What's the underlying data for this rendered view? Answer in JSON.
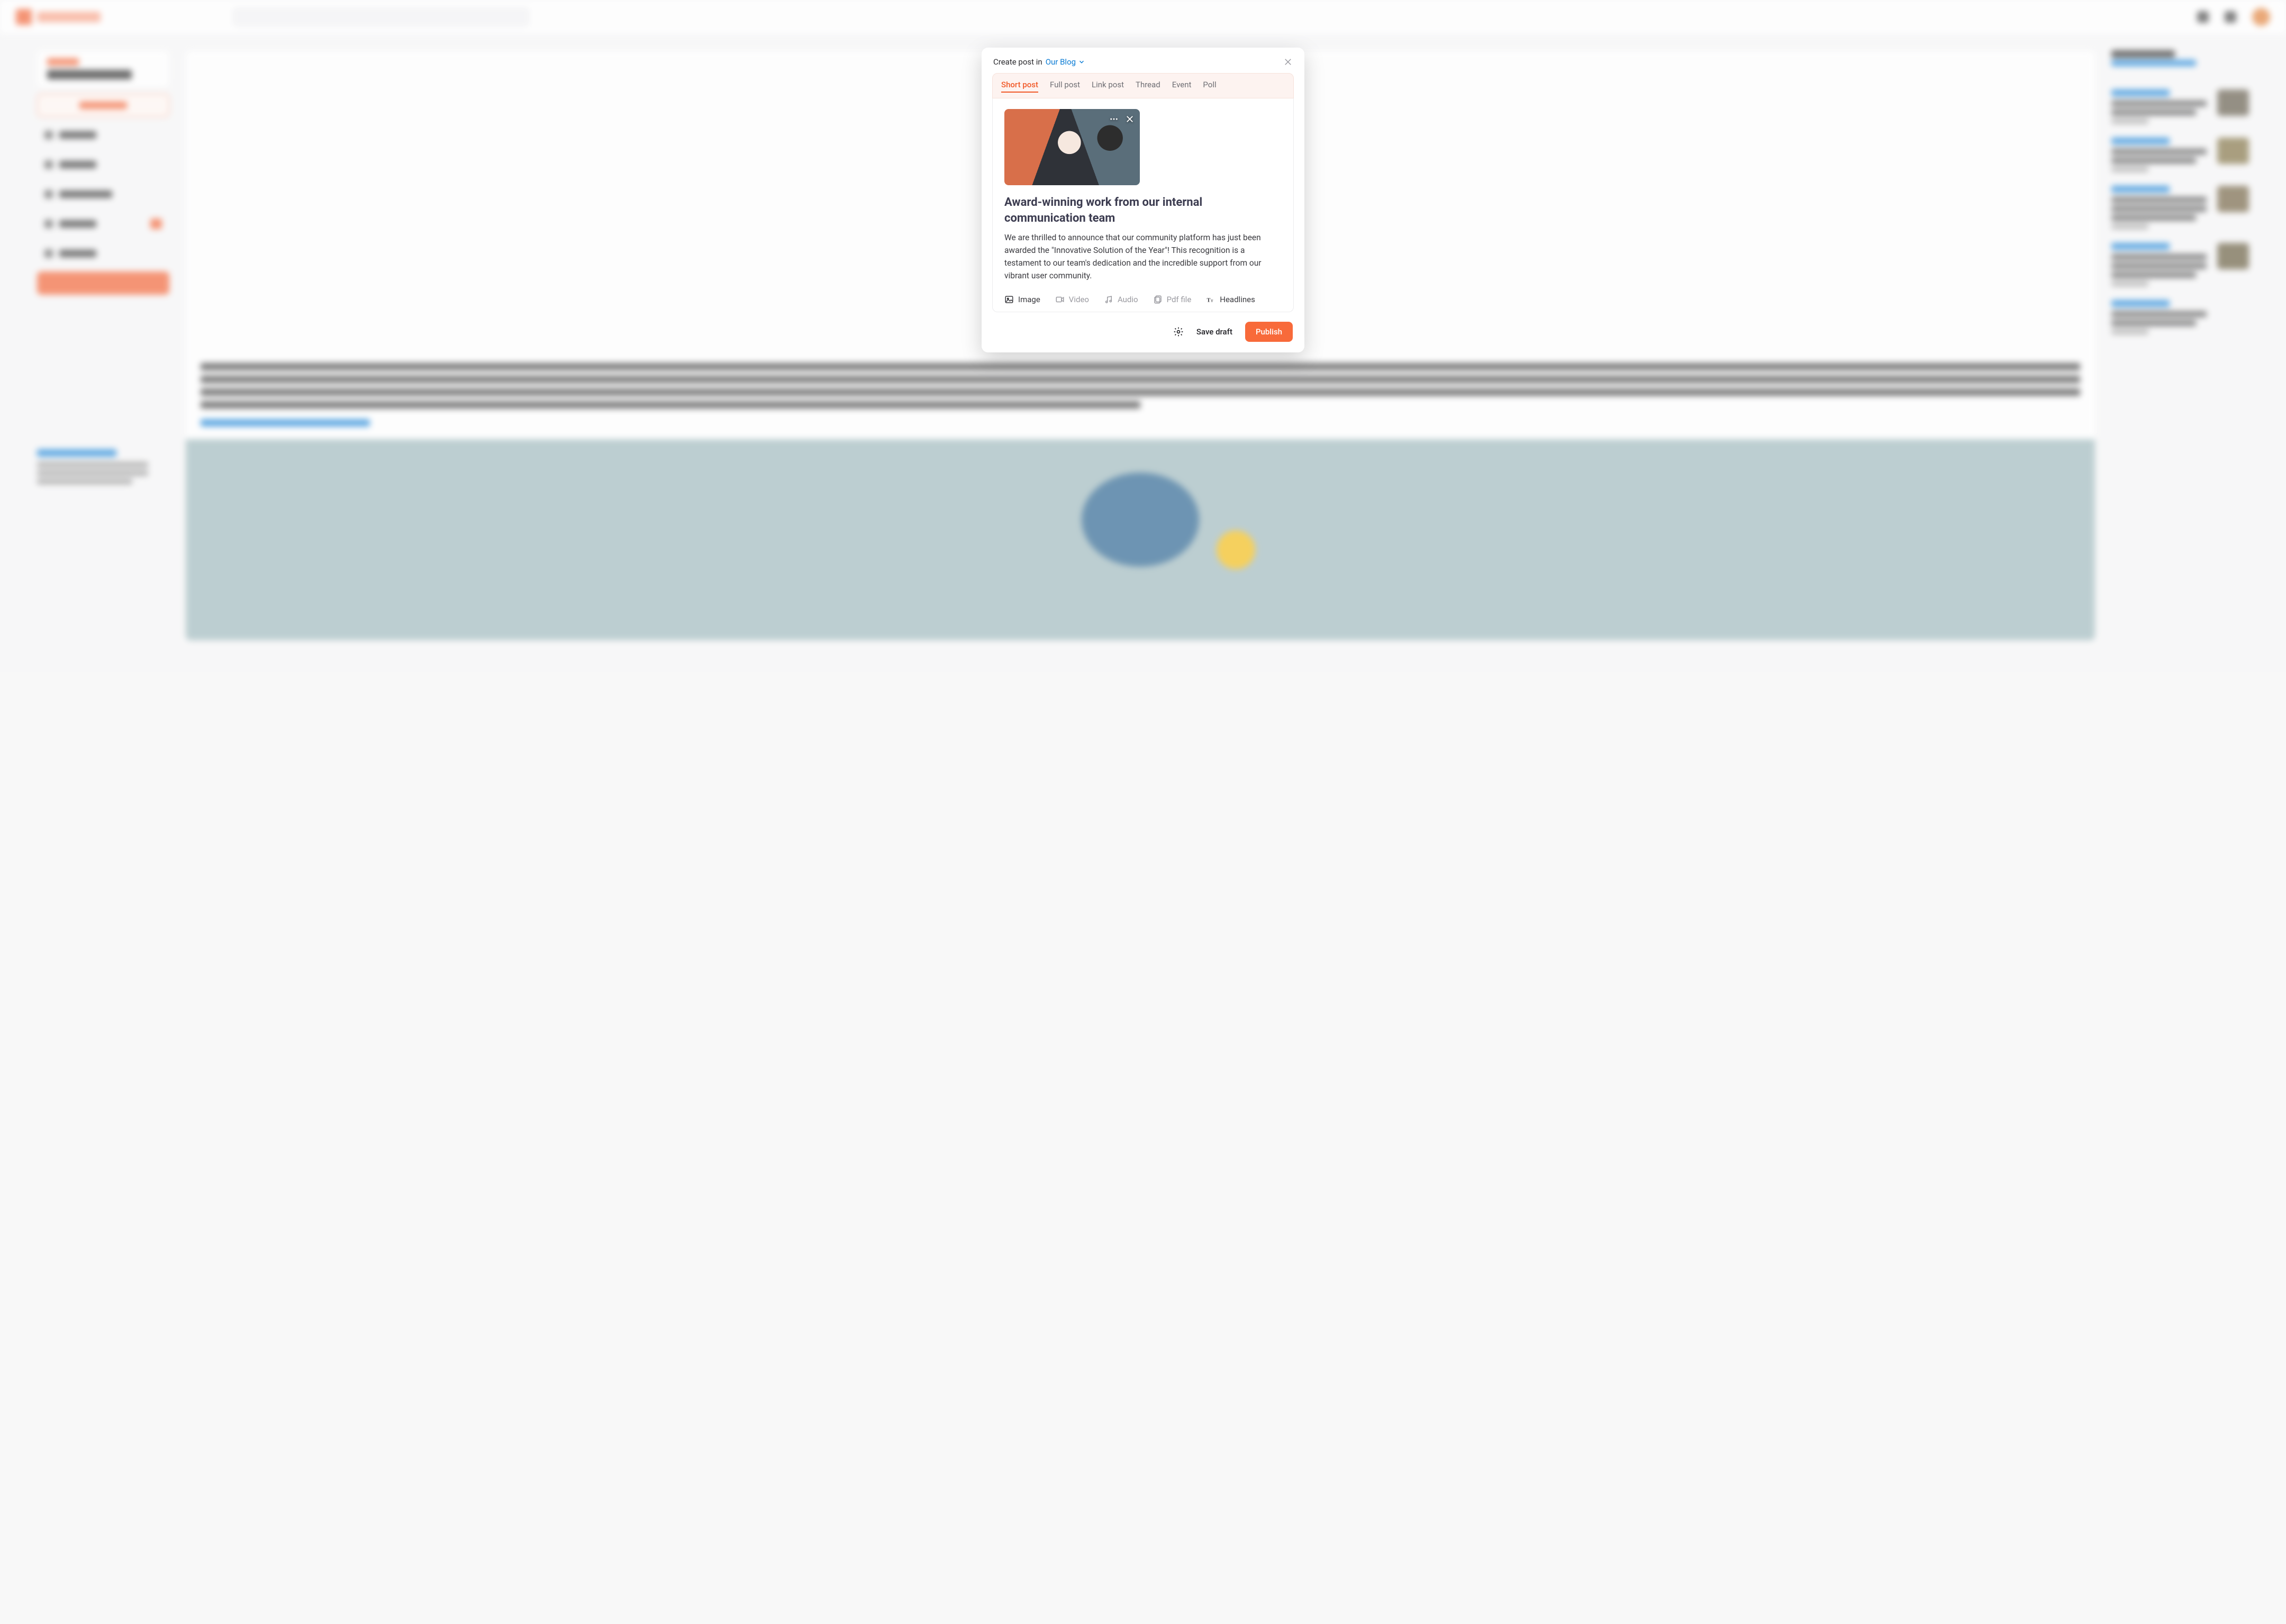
{
  "modal": {
    "header_prefix": "Create post in",
    "blog_name": "Our Blog",
    "tabs": {
      "short_post": "Short post",
      "full_post": "Full post",
      "link_post": "Link post",
      "thread": "Thread",
      "event": "Event",
      "poll": "Poll"
    },
    "active_tab": "short_post",
    "post": {
      "title": "Award-winning work from our internal communication team",
      "body": "We are thrilled to announce that our community platform has just been awarded the \"Innovative Solution of the Year\"! This recognition is a testament to our team's dedication and the incredible support from our vibrant user community."
    },
    "attachment_tools": {
      "image": "Image",
      "video": "Video",
      "audio": "Audio",
      "pdf": "Pdf file",
      "headlines": "Headlines"
    },
    "footer": {
      "save_draft": "Save draft",
      "publish": "Publish"
    }
  },
  "icons": {
    "chevron_down": "chevron-down-icon",
    "close": "close-icon",
    "more": "more-icon",
    "gear": "gear-icon",
    "image": "image-icon",
    "video": "video-icon",
    "audio": "audio-icon",
    "pdf": "pdf-icon",
    "headlines": "headlines-icon"
  },
  "colors": {
    "accent": "#f15a29",
    "link": "#0a7bd4"
  }
}
